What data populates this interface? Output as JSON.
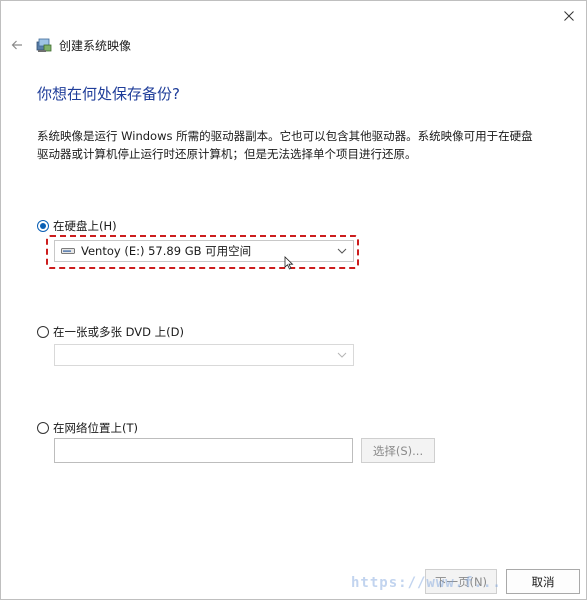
{
  "window": {
    "title": "创建系统映像"
  },
  "page": {
    "heading": "你想在何处保存备份?",
    "description": "系统映像是运行 Windows 所需的驱动器副本。它也可以包含其他驱动器。系统映像可用于在硬盘驱动器或计算机停止运行时还原计算机；但是无法选择单个项目进行还原。"
  },
  "options": {
    "hard_disk": {
      "label": "在硬盘上(H)",
      "checked": true,
      "selected_drive": "Ventoy (E:)  57.89 GB 可用空间"
    },
    "dvd": {
      "label": "在一张或多张 DVD 上(D)",
      "checked": false,
      "selected_drive": ""
    },
    "network": {
      "label": "在网络位置上(T)",
      "checked": false,
      "path_value": "",
      "browse_label": "选择(S)..."
    }
  },
  "footer": {
    "next_label": "下一页(N)",
    "cancel_label": "取消"
  },
  "watermark": "https://www.f...",
  "colors": {
    "heading": "#1f3d99",
    "accent": "#0a5fb5",
    "highlight": "#cc1d1d"
  },
  "icons": [
    "close-icon",
    "back-arrow-icon",
    "backup-app-icon",
    "drive-icon",
    "chevron-down-icon",
    "mouse-cursor-icon"
  ]
}
